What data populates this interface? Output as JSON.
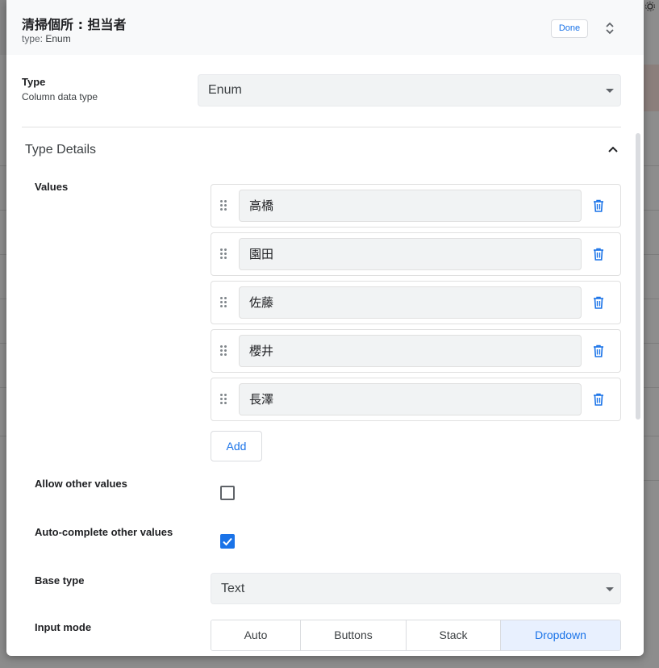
{
  "dialog": {
    "title": "清掃個所 : 担当者",
    "subtitle_prefix": "type:",
    "subtitle_value": "Enum",
    "done_label": "Done"
  },
  "type_field": {
    "label": "Type",
    "sublabel": "Column data type",
    "value": "Enum"
  },
  "type_details": {
    "title": "Type Details",
    "values_label": "Values",
    "values": [
      "高橋",
      "園田",
      "佐藤",
      "櫻井",
      "長澤"
    ],
    "add_label": "Add",
    "allow_other": {
      "label": "Allow other values",
      "checked": false
    },
    "autocomplete": {
      "label": "Auto-complete other values",
      "checked": true
    },
    "base_type": {
      "label": "Base type",
      "value": "Text"
    },
    "input_mode": {
      "label": "Input mode",
      "options": [
        "Auto",
        "Buttons",
        "Stack",
        "Dropdown"
      ],
      "selected": "Dropdown"
    }
  },
  "colors": {
    "accent": "#1a73e8",
    "field_bg": "#f1f3f4",
    "header_bg": "#f8f9fa"
  },
  "icons": [
    "expand-collapse-icon",
    "chevron-up-icon",
    "drag-handle-icon",
    "trash-icon",
    "dropdown-caret-icon",
    "checkmark-icon"
  ]
}
